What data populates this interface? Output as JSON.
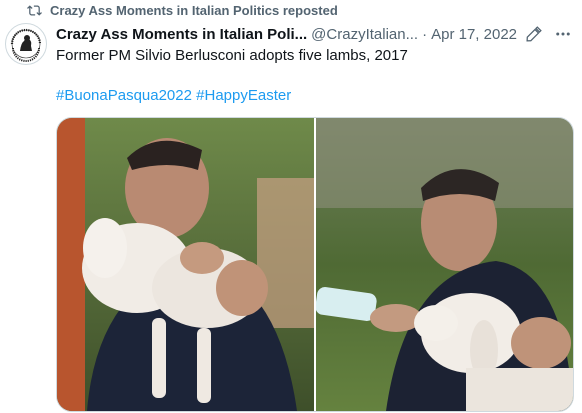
{
  "repost": {
    "label": "Crazy Ass Moments in Italian Politics reposted",
    "icon": "repost-icon"
  },
  "tweet": {
    "display_name": "Crazy Ass Moments in Italian Poli...",
    "handle": "@CrazyItalian...",
    "separator": "·",
    "date": "Apr 17, 2022",
    "text": "Former PM Silvio Berlusconi adopts five lambs, 2017",
    "hashtags": [
      "#BuonaPasqua2022",
      "#HappyEaster"
    ],
    "avatar_text": "CRAZY ASS MOMENTS IN ITALIAN POLITICS",
    "icons": [
      "edited-icon",
      "more-icon"
    ]
  },
  "media": {
    "photos": [
      {
        "name": "photo-hugging-lamb"
      },
      {
        "name": "photo-bottle-feeding-lamb"
      }
    ]
  },
  "colors": {
    "accent": "#1d9bf0",
    "secondary_text": "#536471",
    "primary_text": "#0f1419"
  }
}
